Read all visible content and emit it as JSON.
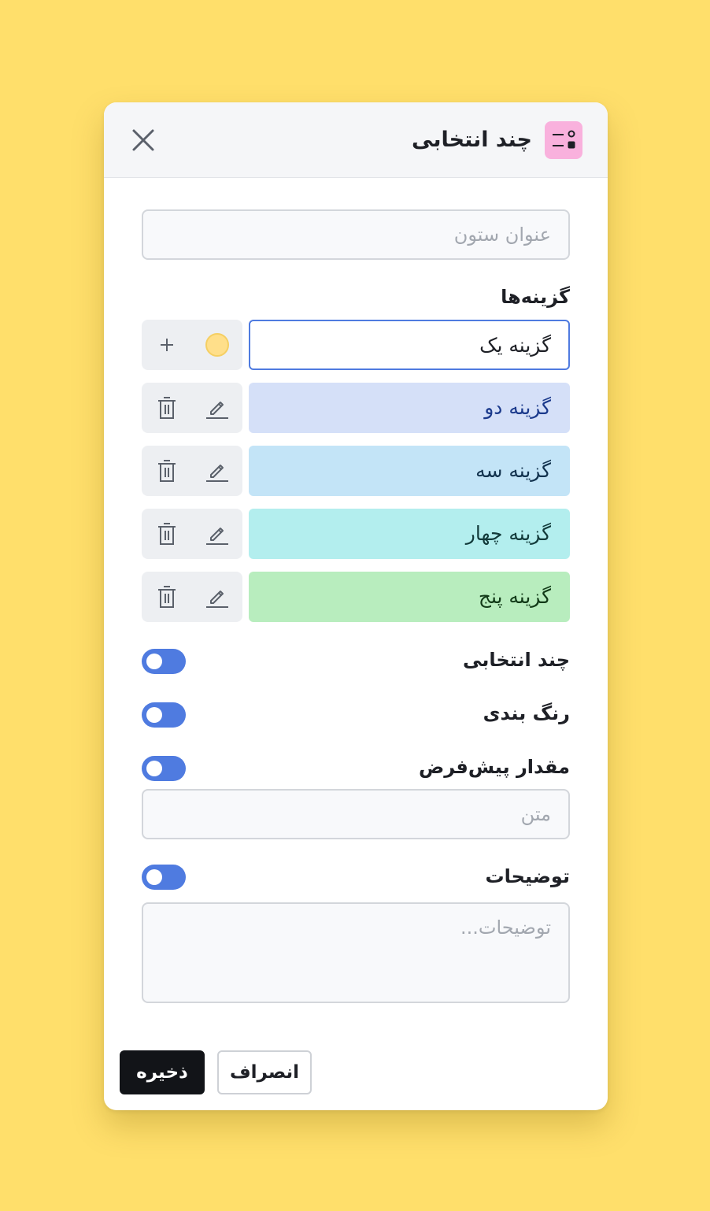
{
  "dialog": {
    "title": "چند انتخابی",
    "header_icon": "list-select-icon",
    "close_icon": "close-icon",
    "colors": {
      "header_icon_bg": "#F9B1DD",
      "background": "#FFDF6B",
      "accent": "#4F7BE0"
    }
  },
  "column_title": {
    "placeholder": "عنوان ستون",
    "value": ""
  },
  "options": {
    "label": "گزینه‌ها",
    "new_option": {
      "value": "گزینه یک",
      "swatch_color": "#FFDF8A",
      "add_icon": "plus-icon"
    },
    "items": [
      {
        "label": "گزینه دو",
        "bg": "#D5E0F8",
        "text_color": "#1B3A8C",
        "edit_icon": "pencil-icon",
        "delete_icon": "trash-icon"
      },
      {
        "label": "گزینه سه",
        "bg": "#C3E4F7",
        "text_color": "#12324E",
        "edit_icon": "pencil-icon",
        "delete_icon": "trash-icon"
      },
      {
        "label": "گزینه چهار",
        "bg": "#B3EEEE",
        "text_color": "#123A3A",
        "edit_icon": "pencil-icon",
        "delete_icon": "trash-icon"
      },
      {
        "label": "گزینه پنج",
        "bg": "#B8EDBE",
        "text_color": "#123A18",
        "edit_icon": "pencil-icon",
        "delete_icon": "trash-icon"
      }
    ]
  },
  "toggles": {
    "multi_select": {
      "label": "چند انتخابی",
      "on": false
    },
    "coloring": {
      "label": "رنگ بندی",
      "on": false
    },
    "default_value": {
      "label": "مقدار پیش‌فرض",
      "on": false,
      "placeholder": "متن",
      "value": ""
    },
    "description": {
      "label": "توضیحات",
      "on": false,
      "placeholder": "توضیحات...",
      "value": ""
    }
  },
  "footer": {
    "save_label": "ذخیره",
    "cancel_label": "انصراف"
  }
}
